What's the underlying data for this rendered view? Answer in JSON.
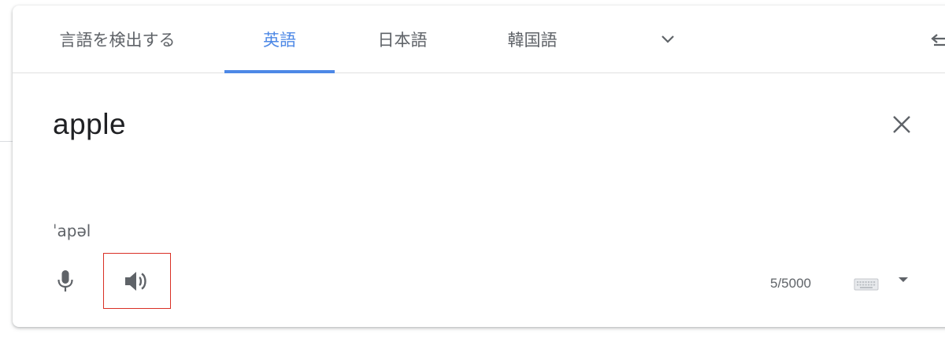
{
  "language_tabs": {
    "detect": "言語を検出する",
    "english": "英語",
    "japanese": "日本語",
    "korean": "韓国語"
  },
  "source": {
    "text": "apple",
    "phonetic": "ˈapəl",
    "char_count": "5/5000"
  },
  "icons": {
    "more_languages": "chevron-down-icon",
    "swap": "swap-languages-icon",
    "clear": "close-icon",
    "microphone": "microphone-icon",
    "speaker": "speaker-icon",
    "keyboard": "keyboard-icon",
    "keyboard_dropdown": "caret-down-icon"
  },
  "colors": {
    "active_tab": "#4d88e6",
    "text_primary": "#202124",
    "text_secondary": "#5f6368",
    "highlight_box": "#d93025"
  }
}
